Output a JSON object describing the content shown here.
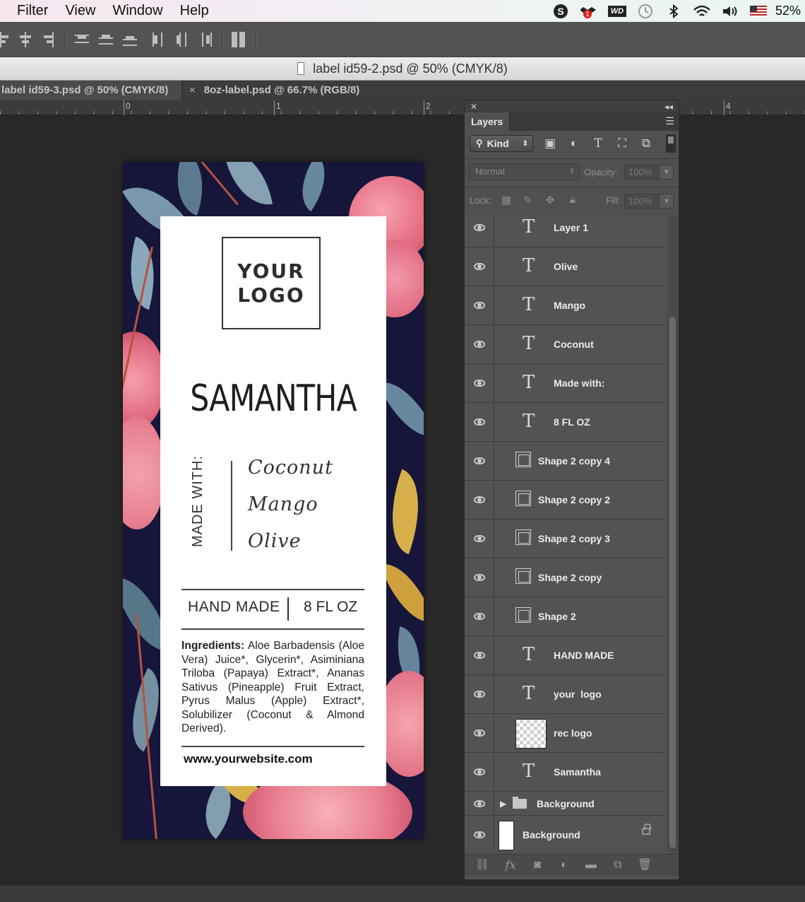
{
  "menubar": {
    "items": [
      "Filter",
      "View",
      "Window",
      "Help"
    ],
    "battery": "52%",
    "status_icons": [
      "skype-icon",
      "dropbox-icon",
      "wd-drive-icon",
      "time-machine-icon",
      "bluetooth-icon",
      "wifi-icon",
      "volume-icon",
      "us-flag-icon"
    ],
    "wd_label": "WD",
    "badge_count": "1"
  },
  "document": {
    "title": "label id59-2.psd @ 50% (CMYK/8)"
  },
  "tabs": [
    {
      "label": "label id59-3.psd @ 50% (CMYK/8)"
    },
    {
      "label": "8oz-label.psd @ 66.7% (RGB/8)",
      "close": "×"
    }
  ],
  "ruler": {
    "labels": [
      "0",
      "1",
      "2",
      "4"
    ]
  },
  "label": {
    "logo_line1": "YOUR",
    "logo_line2": "LOGO",
    "brand": "SAMANTHA",
    "made_with": "MADE WITH:",
    "ingredients_list": [
      "Coconut",
      "Mango",
      "Olive"
    ],
    "hand_made": "HAND MADE",
    "size": "8 FL OZ",
    "ingredients_heading": "Ingredients:",
    "ingredients_text": "Aloe Barbadensis (Aloe Vera) Juice*, Glycerin*, Asiminiana Triloba (Papaya) Extract*, Ananas Sativus (Pineapple) Fruit Extract, Pyrus Malus (Apple) Extract*, Solubilizer (Coconut & Almond Derived).",
    "website": "www.yourwebsite.com",
    "colors": {
      "background": "#16163b",
      "flower": "#ef7d8f",
      "leaf": "#6b8ea3"
    }
  },
  "layers_panel": {
    "tab": "Layers",
    "filter_kind": "Kind",
    "blend_mode": "Normal",
    "opacity_label": "Opacity:",
    "opacity_value": "100%",
    "lock_label": "Lock:",
    "fill_label": "Fill:",
    "fill_value": "100%",
    "layers": [
      {
        "name": "Layer 1",
        "kind": "text"
      },
      {
        "name": "Olive",
        "kind": "text"
      },
      {
        "name": "Mango",
        "kind": "text"
      },
      {
        "name": "Coconut",
        "kind": "text"
      },
      {
        "name": "Made with:",
        "kind": "text"
      },
      {
        "name": "8 FL OZ",
        "kind": "text"
      },
      {
        "name": "Shape 2 copy 4",
        "kind": "shape"
      },
      {
        "name": "Shape 2 copy 2",
        "kind": "shape"
      },
      {
        "name": "Shape 2 copy 3",
        "kind": "shape"
      },
      {
        "name": "Shape 2 copy",
        "kind": "shape"
      },
      {
        "name": "Shape 2",
        "kind": "shape"
      },
      {
        "name": "HAND MADE",
        "kind": "text"
      },
      {
        "name": "your  logo",
        "kind": "text"
      },
      {
        "name": "rec logo",
        "kind": "smart"
      },
      {
        "name": "Samantha",
        "kind": "text"
      },
      {
        "name": "Background",
        "kind": "group"
      },
      {
        "name": "Background",
        "kind": "background"
      }
    ]
  }
}
